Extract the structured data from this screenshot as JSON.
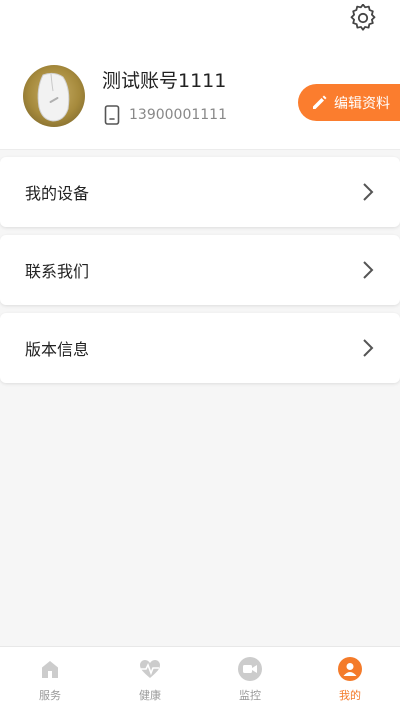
{
  "profile": {
    "username": "测试账号1111",
    "phone": "13900001111",
    "edit_label": "编辑资料"
  },
  "menu": [
    {
      "label": "我的设备"
    },
    {
      "label": "联系我们"
    },
    {
      "label": "版本信息"
    }
  ],
  "tabbar": [
    {
      "label": "服务",
      "icon": "home-icon",
      "active": false
    },
    {
      "label": "健康",
      "icon": "heartbeat-icon",
      "active": false
    },
    {
      "label": "监控",
      "icon": "camera-icon",
      "active": false
    },
    {
      "label": "我的",
      "icon": "user-icon",
      "active": true
    }
  ],
  "colors": {
    "accent": "#fb7d2e",
    "tab_active": "#f47b2a",
    "tab_inactive": "#cccccc"
  }
}
